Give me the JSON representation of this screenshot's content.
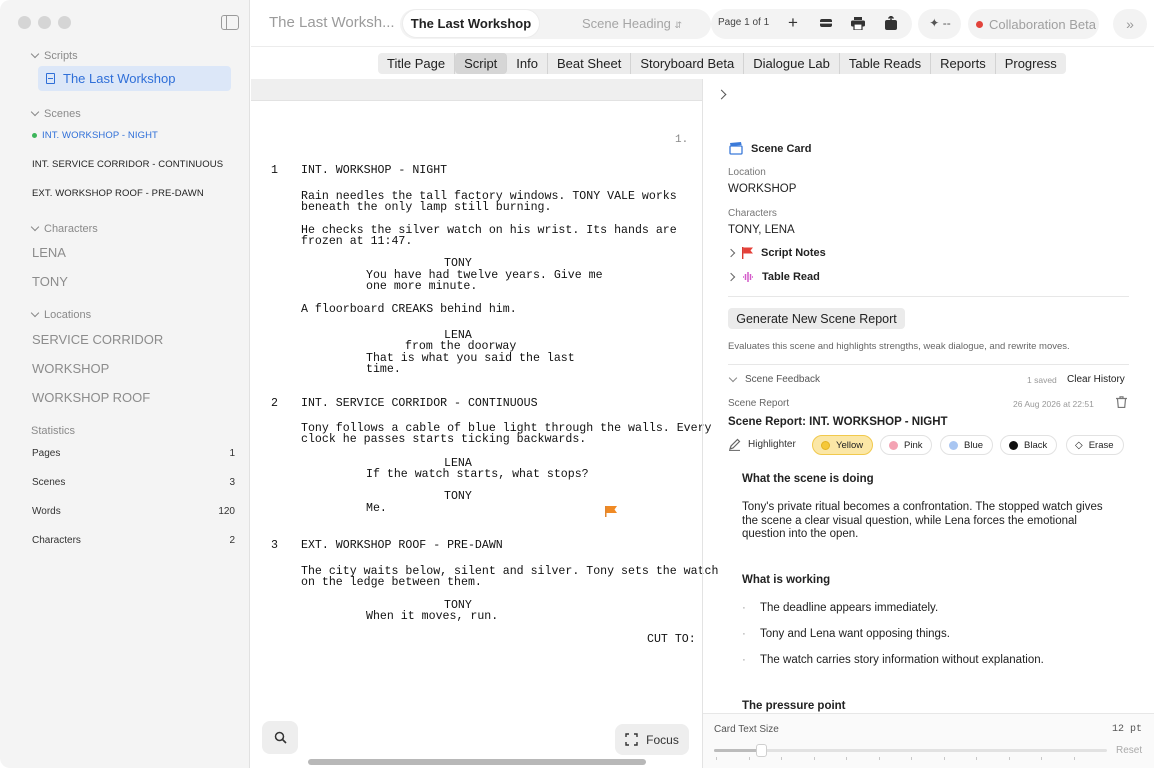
{
  "sidebar": {
    "scripts_header": "Scripts",
    "script_item": "The Last Workshop",
    "scenes_header": "Scenes",
    "scenes": [
      "INT. WORKSHOP - NIGHT",
      "INT. SERVICE CORRIDOR - CONTINUOUS",
      "EXT. WORKSHOP ROOF - PRE-DAWN"
    ],
    "characters_header": "Characters",
    "characters": [
      "LENA",
      "TONY"
    ],
    "locations_header": "Locations",
    "locations": [
      "SERVICE CORRIDOR",
      "WORKSHOP",
      "WORKSHOP ROOF"
    ],
    "statistics_header": "Statistics",
    "stats": [
      {
        "label": "Pages",
        "value": "1"
      },
      {
        "label": "Scenes",
        "value": "3"
      },
      {
        "label": "Words",
        "value": "120"
      },
      {
        "label": "Characters",
        "value": "2"
      }
    ]
  },
  "toolbar": {
    "title": "The Last Worksh...",
    "active_tab": "The Last Workshop",
    "scene_heading": "Scene Heading",
    "page_indicator": "Page 1 of 1",
    "new_icon": "+",
    "spark_value": "--",
    "collab_label": "Collaboration Beta"
  },
  "tabs": [
    "Title Page",
    "Script",
    "Info",
    "Beat Sheet",
    "Storyboard Beta",
    "Dialogue Lab",
    "Table Reads",
    "Reports",
    "Progress"
  ],
  "script": {
    "page_number": "1.",
    "lines": [
      {
        "n": "1",
        "text": "INT. WORKSHOP - NIGHT",
        "indent": "action"
      },
      {
        "text": "Rain needles the tall factory windows. TONY VALE works",
        "indent": "action"
      },
      {
        "text": "beneath the only lamp still burning.",
        "indent": "action"
      },
      {
        "text": "He checks the silver watch on his wrist. Its hands are",
        "indent": "action"
      },
      {
        "text": "frozen at 11:47.",
        "indent": "action"
      },
      {
        "text": "TONY",
        "indent": "char"
      },
      {
        "text": "You have had twelve years. Give me",
        "indent": "dial"
      },
      {
        "text": "one more minute.",
        "indent": "dial"
      },
      {
        "text": "A floorboard CREAKS behind him.",
        "indent": "action"
      },
      {
        "text": "LENA",
        "indent": "char"
      },
      {
        "text": "from the doorway",
        "indent": "paren"
      },
      {
        "text": "That is what you said the last",
        "indent": "dial"
      },
      {
        "text": "time.",
        "indent": "dial"
      },
      {
        "n": "2",
        "text": "INT. SERVICE CORRIDOR - CONTINUOUS",
        "indent": "action"
      },
      {
        "text": "Tony follows a cable of blue light through the walls. Every",
        "indent": "action"
      },
      {
        "text": "clock he passes starts ticking backwards.",
        "indent": "action"
      },
      {
        "text": "LENA",
        "indent": "char"
      },
      {
        "text": "If the watch starts, what stops?",
        "indent": "dial"
      },
      {
        "text": "TONY",
        "indent": "char"
      },
      {
        "text": "Me.",
        "indent": "dial"
      },
      {
        "n": "3",
        "text": "EXT. WORKSHOP ROOF - PRE-DAWN",
        "indent": "action"
      },
      {
        "text": "The city waits below, silent and silver. Tony sets the watch",
        "indent": "action"
      },
      {
        "text": "on the ledge between them.",
        "indent": "action"
      },
      {
        "text": "TONY",
        "indent": "char"
      },
      {
        "text": "When it moves, run.",
        "indent": "dial"
      },
      {
        "text": "CUT TO:",
        "indent": "trans"
      }
    ],
    "focus_label": "Focus"
  },
  "inspector": {
    "card_title": "Scene Card",
    "location_label": "Location",
    "location_value": "WORKSHOP",
    "characters_label": "Characters",
    "characters_value": "TONY, LENA",
    "script_notes": "Script Notes",
    "table_read": "Table Read",
    "generate_button": "Generate New Scene Report",
    "generate_desc": "Evaluates this scene and highlights strengths, weak dialogue, and rewrite moves.",
    "feedback_label": "Scene Feedback",
    "saved_count": "1 saved",
    "clear_history": "Clear History",
    "report_label": "Scene Report",
    "report_date": "26 Aug 2026 at 22:51",
    "report_title": "Scene Report: INT. WORKSHOP - NIGHT",
    "highlighter_label": "Highlighter",
    "highlight_colors": [
      {
        "name": "Yellow",
        "color": "#f5c83a"
      },
      {
        "name": "Pink",
        "color": "#f4a3b4"
      },
      {
        "name": "Blue",
        "color": "#a9c6f2"
      },
      {
        "name": "Black",
        "color": "#111111"
      },
      {
        "name": "Erase",
        "color": "none"
      }
    ],
    "section1_heading": "What the scene is doing",
    "section1_lines": [
      "Tony's private ritual becomes a confrontation. The stopped watch gives",
      "the scene a clear visual question, while Lena forces the emotional",
      "question into the open."
    ],
    "section2_heading": "What is working",
    "section2_bullets": [
      "The deadline appears immediately.",
      "Tony and Lena want opposing things.",
      "The watch carries story information without explanation."
    ],
    "section3_heading": "The pressure point",
    "text_size_label": "Card Text Size",
    "text_size_value": "12 pt",
    "text_size_level": 0.12,
    "reset_label": "Reset"
  }
}
